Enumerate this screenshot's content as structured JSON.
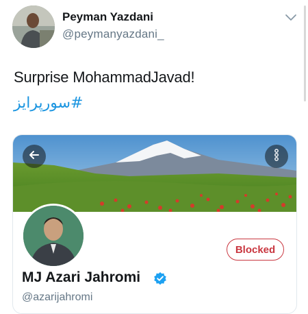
{
  "tweet": {
    "author_name": "Peyman Yazdani",
    "author_handle": "@peymanyazdani_",
    "text": "Surprise MohammadJavad!",
    "hashtag": "#سورپرایز"
  },
  "profile_card": {
    "name": "MJ Azari Jahromi",
    "handle": "@azarijahromi",
    "blocked_label": "Blocked",
    "verified": true
  },
  "icons": {
    "caret": "chevron-down-icon",
    "back": "arrow-left-icon",
    "more": "more-vertical-icon",
    "verified": "verified-badge-icon"
  },
  "colors": {
    "link": "#1b95e0",
    "blocked": "#c9363f",
    "verified": "#1da1f2",
    "secondary_text": "#657786"
  }
}
